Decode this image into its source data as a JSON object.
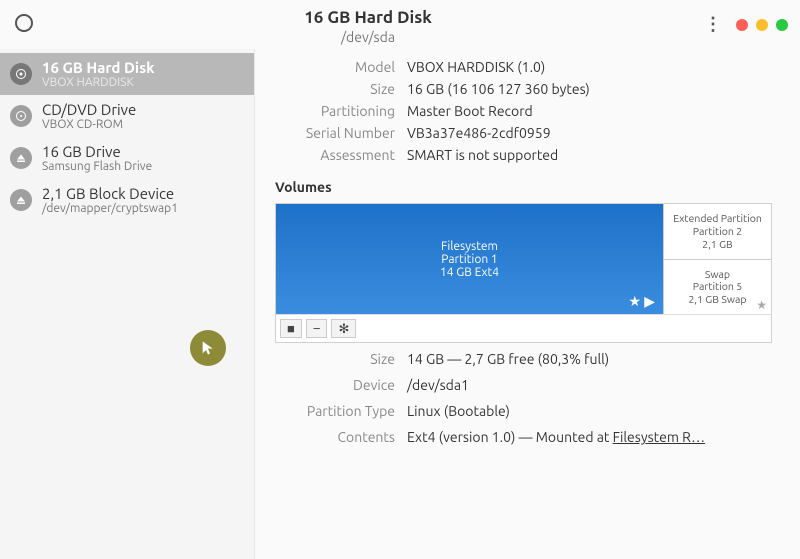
{
  "header": {
    "title": "16 GB Hard Disk",
    "subtitle": "/dev/sda"
  },
  "sidebar": {
    "items": [
      {
        "title": "16 GB Hard Disk",
        "sub": "VBOX HARDDISK",
        "icon": "disk",
        "selected": true
      },
      {
        "title": "CD/DVD Drive",
        "sub": "VBOX CD-ROM",
        "icon": "disc",
        "selected": false
      },
      {
        "title": "16 GB Drive",
        "sub": "Samsung Flash Drive",
        "icon": "eject",
        "selected": false
      },
      {
        "title": "2,1 GB Block Device",
        "sub": "/dev/mapper/cryptswap1",
        "icon": "eject",
        "selected": false
      }
    ]
  },
  "disk": {
    "model_label": "Model",
    "model": "VBOX HARDDISK (1.0)",
    "size_label": "Size",
    "size": "16 GB (16 106 127 360 bytes)",
    "part_label": "Partitioning",
    "partitioning": "Master Boot Record",
    "serial_label": "Serial Number",
    "serial": "VB3a37e486-2cdf0959",
    "assess_label": "Assessment",
    "assessment": "SMART is not supported"
  },
  "volumes": {
    "title": "Volumes",
    "main": {
      "line1": "Filesystem",
      "line2": "Partition 1",
      "line3": "14 GB Ext4"
    },
    "ext": {
      "line1": "Extended Partition",
      "line2": "Partition 2",
      "line3": "2,1 GB"
    },
    "swap": {
      "line1": "Swap",
      "line2": "Partition 5",
      "line3": "2,1 GB Swap"
    },
    "toolbar": {
      "stop": "■",
      "minus": "−",
      "gear": "✻"
    }
  },
  "partition": {
    "size_label": "Size",
    "size": "14 GB — 2,7 GB free (80,3% full)",
    "device_label": "Device",
    "device": "/dev/sda1",
    "type_label": "Partition Type",
    "type": "Linux (Bootable)",
    "contents_label": "Contents",
    "contents_pre": "Ext4 (version 1.0) — Mounted at ",
    "contents_link": "Filesystem R…"
  }
}
